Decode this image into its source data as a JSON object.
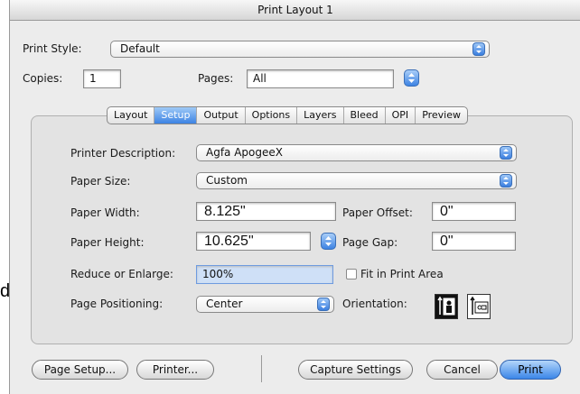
{
  "window": {
    "title": "Print Layout 1"
  },
  "stray_text": "d.",
  "top": {
    "print_style_label": "Print Style:",
    "print_style_value": "Default",
    "copies_label": "Copies:",
    "copies_value": "1",
    "pages_label": "Pages:",
    "pages_value": "All"
  },
  "tabs": [
    {
      "label": "Layout",
      "active": false
    },
    {
      "label": "Setup",
      "active": true
    },
    {
      "label": "Output",
      "active": false
    },
    {
      "label": "Options",
      "active": false
    },
    {
      "label": "Layers",
      "active": false
    },
    {
      "label": "Bleed",
      "active": false
    },
    {
      "label": "OPI",
      "active": false
    },
    {
      "label": "Preview",
      "active": false
    }
  ],
  "setup": {
    "printer_description_label": "Printer Description:",
    "printer_description_value": "Agfa ApogeeX",
    "paper_size_label": "Paper Size:",
    "paper_size_value": "Custom",
    "paper_width_label": "Paper Width:",
    "paper_width_value": "8.125\"",
    "paper_offset_label": "Paper Offset:",
    "paper_offset_value": "0\"",
    "paper_height_label": "Paper Height:",
    "paper_height_value": "10.625\"",
    "page_gap_label": "Page Gap:",
    "page_gap_value": "0\"",
    "reduce_label": "Reduce or Enlarge:",
    "reduce_value": "100%",
    "fit_label": "Fit in Print Area",
    "fit_checked": false,
    "page_positioning_label": "Page Positioning:",
    "page_positioning_value": "Center",
    "orientation_label": "Orientation:",
    "orientation_selected": "portrait"
  },
  "buttons": {
    "page_setup": "Page Setup...",
    "printer": "Printer...",
    "capture_settings": "Capture Settings",
    "cancel": "Cancel",
    "print": "Print"
  },
  "colors": {
    "accent": "#3b86e8",
    "window_bg": "#ececec"
  }
}
